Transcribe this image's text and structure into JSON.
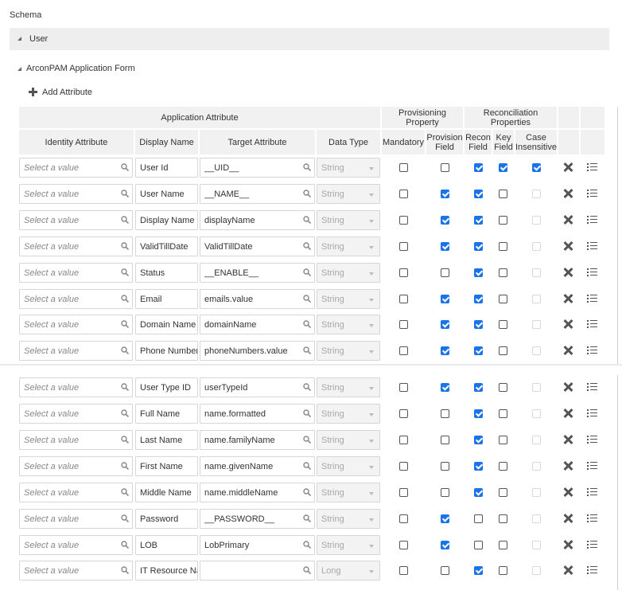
{
  "schema_label": "Schema",
  "object": {
    "label": "User"
  },
  "form": {
    "title": "ArconPAM Application Form",
    "add_attribute_label": "Add Attribute"
  },
  "headers": {
    "application_attribute": "Application Attribute",
    "provisioning_property": "Provisioning Property",
    "reconciliation_properties": "Reconciliation Properties",
    "identity_attribute": "Identity Attribute",
    "display_name": "Display Name",
    "target_attribute": "Target Attribute",
    "data_type": "Data Type",
    "mandatory": "Mandatory",
    "provision_field": "Provision Field",
    "recon_field": "Recon Field",
    "key_field": "Key Field",
    "case_insensitive": "Case Insensitive"
  },
  "identity_placeholder": "Select a value",
  "rows": [
    {
      "display_name": "User Id",
      "target": "__UID__",
      "data_type": "String",
      "mandatory": false,
      "provision": false,
      "recon": true,
      "key": true,
      "case_insensitive": true
    },
    {
      "display_name": "User Name",
      "target": "__NAME__",
      "data_type": "String",
      "mandatory": false,
      "provision": true,
      "recon": true,
      "key": false,
      "case_insensitive": false
    },
    {
      "display_name": "Display Name",
      "target": "displayName",
      "data_type": "String",
      "mandatory": false,
      "provision": true,
      "recon": true,
      "key": false,
      "case_insensitive": false
    },
    {
      "display_name": "ValidTillDate",
      "target": "ValidTillDate",
      "data_type": "String",
      "mandatory": false,
      "provision": true,
      "recon": true,
      "key": false,
      "case_insensitive": false
    },
    {
      "display_name": "Status",
      "target": "__ENABLE__",
      "data_type": "String",
      "mandatory": false,
      "provision": false,
      "recon": true,
      "key": false,
      "case_insensitive": false
    },
    {
      "display_name": "Email",
      "target": "emails.value",
      "data_type": "String",
      "mandatory": false,
      "provision": true,
      "recon": true,
      "key": false,
      "case_insensitive": false
    },
    {
      "display_name": "Domain Name",
      "target": "domainName",
      "data_type": "String",
      "mandatory": false,
      "provision": true,
      "recon": true,
      "key": false,
      "case_insensitive": false
    },
    {
      "display_name": "Phone Number",
      "target": "phoneNumbers.value",
      "data_type": "String",
      "mandatory": false,
      "provision": true,
      "recon": true,
      "key": false,
      "case_insensitive": false
    },
    {
      "display_name": "User Type ID",
      "target": "userTypeId",
      "data_type": "String",
      "mandatory": false,
      "provision": true,
      "recon": true,
      "key": false,
      "case_insensitive": false
    },
    {
      "display_name": "Full Name",
      "target": "name.formatted",
      "data_type": "String",
      "mandatory": false,
      "provision": false,
      "recon": true,
      "key": false,
      "case_insensitive": false
    },
    {
      "display_name": "Last Name",
      "target": "name.familyName",
      "data_type": "String",
      "mandatory": false,
      "provision": false,
      "recon": true,
      "key": false,
      "case_insensitive": false
    },
    {
      "display_name": "First Name",
      "target": "name.givenName",
      "data_type": "String",
      "mandatory": false,
      "provision": false,
      "recon": true,
      "key": false,
      "case_insensitive": false
    },
    {
      "display_name": "Middle Name",
      "target": "name.middleName",
      "data_type": "String",
      "mandatory": false,
      "provision": false,
      "recon": true,
      "key": false,
      "case_insensitive": false
    },
    {
      "display_name": "Password",
      "target": "__PASSWORD__",
      "data_type": "String",
      "mandatory": false,
      "provision": true,
      "recon": false,
      "key": false,
      "case_insensitive": false
    },
    {
      "display_name": "LOB",
      "target": "LobPrimary",
      "data_type": "String",
      "mandatory": false,
      "provision": true,
      "recon": false,
      "key": false,
      "case_insensitive": false
    },
    {
      "display_name": "IT Resource Nar",
      "target": "",
      "data_type": "Long",
      "mandatory": false,
      "provision": false,
      "recon": true,
      "key": false,
      "case_insensitive": false
    }
  ],
  "icons": {
    "search": "search-icon",
    "delete": "delete-icon",
    "details": "list-icon",
    "dropdown": "chevron-down-icon"
  },
  "colors": {
    "checked": "#1a73e8",
    "header_bg": "#f1f1f1"
  }
}
